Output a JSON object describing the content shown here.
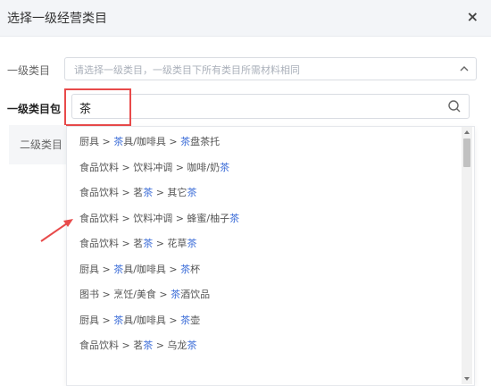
{
  "dialog": {
    "title": "选择一级经营类目",
    "close": "×"
  },
  "level1": {
    "label": "一级类目",
    "placeholder": "请选择一级类目，一级类目下所有类目所需材料相同"
  },
  "package": {
    "label": "一级类目包",
    "search_value": "茶"
  },
  "level2": {
    "label": "二级类目"
  },
  "options": [
    [
      {
        "t": "厨具 > ",
        "h": false
      },
      {
        "t": "茶",
        "h": true
      },
      {
        "t": "具/咖啡具 > ",
        "h": false
      },
      {
        "t": "茶",
        "h": true
      },
      {
        "t": "盘茶托",
        "h": false
      }
    ],
    [
      {
        "t": "食品饮料 > 饮料冲调 > 咖啡/奶",
        "h": false
      },
      {
        "t": "茶",
        "h": true
      }
    ],
    [
      {
        "t": "食品饮料 > 茗",
        "h": false
      },
      {
        "t": "茶",
        "h": true
      },
      {
        "t": " > 其它",
        "h": false
      },
      {
        "t": "茶",
        "h": true
      }
    ],
    [
      {
        "t": "食品饮料 > 饮料冲调 > 蜂蜜/柚子",
        "h": false
      },
      {
        "t": "茶",
        "h": true
      }
    ],
    [
      {
        "t": "食品饮料 > 茗",
        "h": false
      },
      {
        "t": "茶",
        "h": true
      },
      {
        "t": " > 花草",
        "h": false
      },
      {
        "t": "茶",
        "h": true
      }
    ],
    [
      {
        "t": "厨具 > ",
        "h": false
      },
      {
        "t": "茶",
        "h": true
      },
      {
        "t": "具/咖啡具 > ",
        "h": false
      },
      {
        "t": "茶",
        "h": true
      },
      {
        "t": "杯",
        "h": false
      }
    ],
    [
      {
        "t": "图书 > 烹饪/美食 > ",
        "h": false
      },
      {
        "t": "茶",
        "h": true
      },
      {
        "t": "酒饮品",
        "h": false
      }
    ],
    [
      {
        "t": "厨具 > ",
        "h": false
      },
      {
        "t": "茶",
        "h": true
      },
      {
        "t": "具/咖啡具 > ",
        "h": false
      },
      {
        "t": "茶",
        "h": true
      },
      {
        "t": "壶",
        "h": false
      }
    ],
    [
      {
        "t": "食品饮料 > 茗",
        "h": false
      },
      {
        "t": "茶",
        "h": true
      },
      {
        "t": " > 乌龙",
        "h": false
      },
      {
        "t": "茶",
        "h": true
      }
    ]
  ],
  "colors": {
    "highlight": "#3f6fd8",
    "annotation": "#e84a4a"
  }
}
